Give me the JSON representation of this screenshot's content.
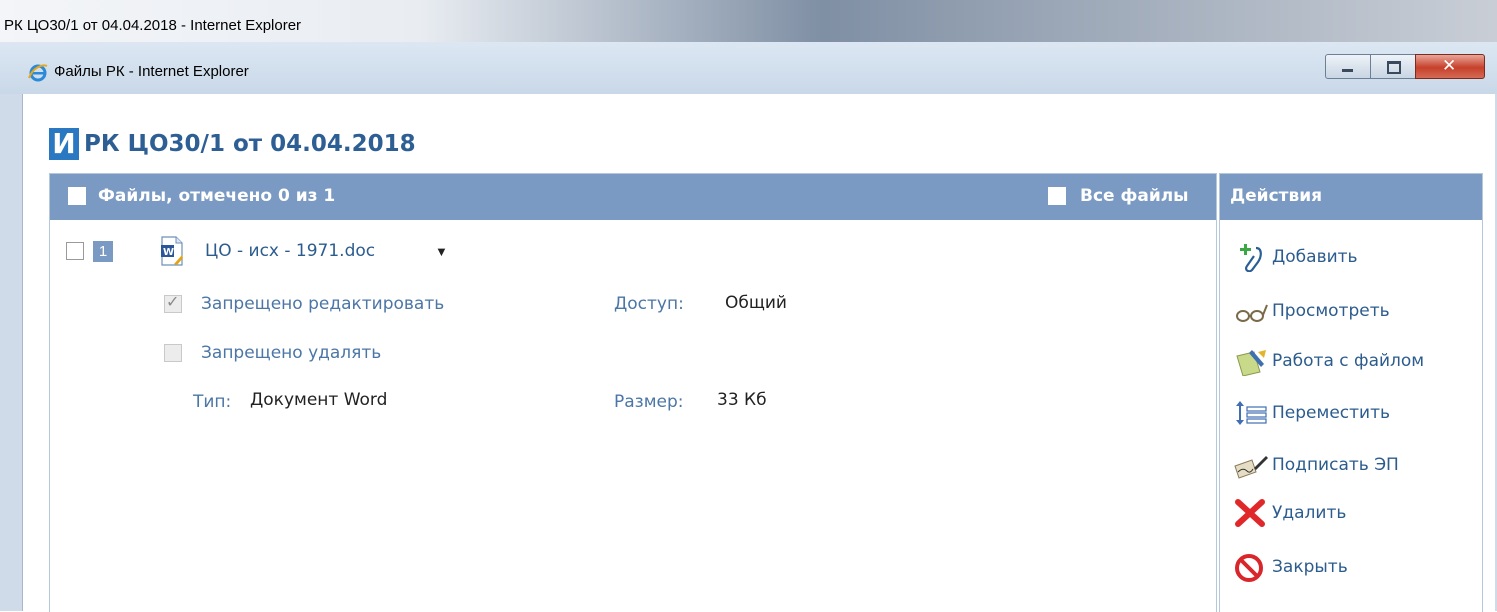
{
  "outer_window": {
    "title": "РК ЦО30/1 от 04.04.2018 - Internet Explorer"
  },
  "window": {
    "title": "Файлы РК - Internet Explorer"
  },
  "document": {
    "badge": "И",
    "title": "РК ЦО30/1 от 04.04.2018"
  },
  "files": {
    "header": "Файлы, отмечено 0 из 1",
    "all_files_label": "Все файлы",
    "items": [
      {
        "number": "1",
        "name": "ЦО - исх - 1971.doc",
        "no_edit_label": "Запрещено редактировать",
        "no_edit_checked": true,
        "no_delete_label": "Запрещено удалять",
        "no_delete_checked": false,
        "access_label": "Доступ:",
        "access_value": "Общий",
        "type_label": "Тип:",
        "type_value": "Документ Word",
        "size_label": "Размер:",
        "size_value": "33 Кб"
      }
    ]
  },
  "actions": {
    "header": "Действия",
    "items": [
      {
        "label": "Добавить",
        "icon": "add-attachment-icon"
      },
      {
        "label": "Просмотреть",
        "icon": "glasses-icon"
      },
      {
        "label": "Работа с файлом",
        "icon": "edit-file-icon"
      },
      {
        "label": "Переместить",
        "icon": "move-icon"
      },
      {
        "label": "Подписать ЭП",
        "icon": "sign-icon"
      },
      {
        "label": "Удалить",
        "icon": "delete-icon"
      },
      {
        "label": "Закрыть",
        "icon": "close-circle-icon"
      }
    ]
  },
  "colors": {
    "panel_header": "#7b9ac3",
    "link": "#2c5c8e",
    "label": "#4b76a6",
    "title": "#2d5f94",
    "badge": "#2a78c2"
  }
}
